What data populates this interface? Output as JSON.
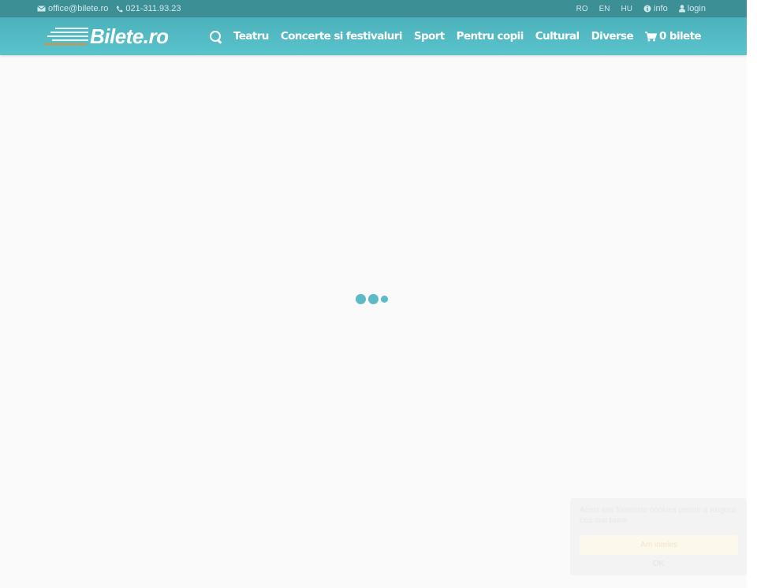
{
  "topbar": {
    "email": "office@bilete.ro",
    "phone": "021-311.93.23",
    "languages": [
      "RO",
      "EN",
      "HU"
    ],
    "info": "info",
    "login": "login"
  },
  "header": {
    "logo_text": "Bilete.ro",
    "nav": [
      "Teatru",
      "Concerte si festivaluri",
      "Sport",
      "Pentru copii",
      "Cultural",
      "Diverse"
    ],
    "cart_label": "0 bilete"
  },
  "colors": {
    "topbar_bg": "#3d8f96",
    "navbar_bg": "#4cb1bb",
    "loader": "#5bbcc5",
    "accent_orange": "#e88a3c"
  },
  "cookie": {
    "message": "Acest site foloseste cookies pentru a asigura cea mai buna",
    "accept_label": "Am inteles",
    "ok_label": "OK"
  }
}
